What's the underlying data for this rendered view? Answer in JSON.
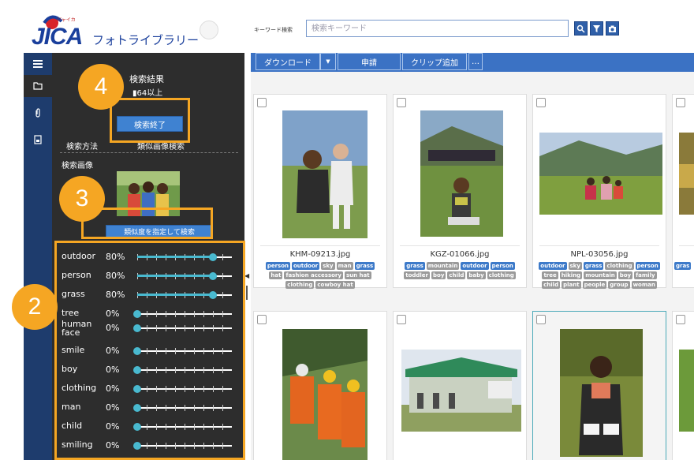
{
  "header": {
    "app_title": "フォトライブラリー",
    "logo_text": "JICA",
    "logo_sub": "ジャイカ",
    "keyword_label": "キーワード検索",
    "search_placeholder": "検索キーワード"
  },
  "panel": {
    "results_title": "検索結果",
    "results_count": "64以上",
    "end_button": "検索終了",
    "method_label": "検索方法",
    "method_value": "類似画像検索",
    "image_label": "検索画像",
    "similarity_button": "類似度を指定して検索",
    "tags": [
      {
        "name": "outdoor",
        "percent_label": "80%",
        "value": 0.8
      },
      {
        "name": "person",
        "percent_label": "80%",
        "value": 0.8
      },
      {
        "name": "grass",
        "percent_label": "80%",
        "value": 0.8
      },
      {
        "name": "tree",
        "percent_label": "0%",
        "value": 0
      },
      {
        "name": "human face",
        "percent_label": "0%",
        "value": 0
      },
      {
        "name": "smile",
        "percent_label": "0%",
        "value": 0
      },
      {
        "name": "boy",
        "percent_label": "0%",
        "value": 0
      },
      {
        "name": "clothing",
        "percent_label": "0%",
        "value": 0
      },
      {
        "name": "man",
        "percent_label": "0%",
        "value": 0
      },
      {
        "name": "child",
        "percent_label": "0%",
        "value": 0
      },
      {
        "name": "smiling",
        "percent_label": "0%",
        "value": 0
      }
    ]
  },
  "toolbar": {
    "download": "ダウンロード",
    "apply": "申請",
    "clip_add": "クリップ追加",
    "more": "…"
  },
  "photos": [
    {
      "filename": "KHM-09213.jpg",
      "tags": [
        {
          "text": "person",
          "style": "b"
        },
        {
          "text": "outdoor",
          "style": "b"
        },
        {
          "text": "sky",
          "style": "g"
        },
        {
          "text": "man",
          "style": "g"
        },
        {
          "text": "grass",
          "style": "b"
        },
        {
          "text": "hat",
          "style": "g"
        },
        {
          "text": "fashion accessory",
          "style": "g"
        },
        {
          "text": "sun hat",
          "style": "g"
        },
        {
          "text": "clothing",
          "style": "g"
        },
        {
          "text": "cowboy hat",
          "style": "g"
        }
      ]
    },
    {
      "filename": "KGZ-01066.jpg",
      "tags": [
        {
          "text": "grass",
          "style": "b"
        },
        {
          "text": "mountain",
          "style": "g"
        },
        {
          "text": "outdoor",
          "style": "b"
        },
        {
          "text": "person",
          "style": "b"
        },
        {
          "text": "toddler",
          "style": "g"
        },
        {
          "text": "boy",
          "style": "g"
        },
        {
          "text": "child",
          "style": "g"
        },
        {
          "text": "baby",
          "style": "g"
        },
        {
          "text": "clothing",
          "style": "g"
        }
      ]
    },
    {
      "filename": "NPL-03056.jpg",
      "tags": [
        {
          "text": "outdoor",
          "style": "b"
        },
        {
          "text": "sky",
          "style": "g"
        },
        {
          "text": "grass",
          "style": "b"
        },
        {
          "text": "clothing",
          "style": "g"
        },
        {
          "text": "person",
          "style": "b"
        },
        {
          "text": "tree",
          "style": "g"
        },
        {
          "text": "hiking",
          "style": "g"
        },
        {
          "text": "mountain",
          "style": "g"
        },
        {
          "text": "boy",
          "style": "g"
        },
        {
          "text": "family",
          "style": "g"
        },
        {
          "text": "child",
          "style": "g"
        },
        {
          "text": "plant",
          "style": "g"
        },
        {
          "text": "people",
          "style": "g"
        },
        {
          "text": "group",
          "style": "g"
        },
        {
          "text": "woman",
          "style": "g"
        }
      ]
    },
    {
      "filename": "",
      "tags": [
        {
          "text": "gras",
          "style": "b"
        }
      ]
    }
  ],
  "annotations": {
    "step2": "2",
    "step3": "3",
    "step4": "4"
  },
  "colors": {
    "accent_orange": "#f5a623",
    "primary_blue": "#3b72c4",
    "panel_dark": "#2d2d2d",
    "slider_teal": "#49b9cf"
  }
}
